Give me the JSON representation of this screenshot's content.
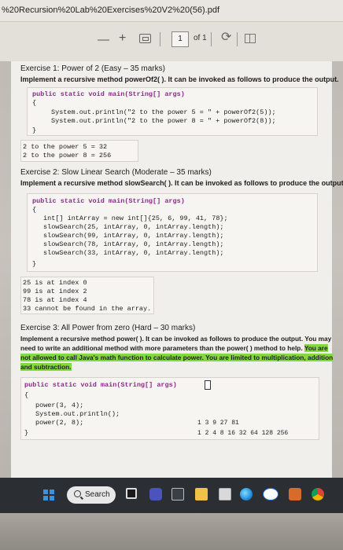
{
  "window": {
    "title": "%20Recursion%20Lab%20Exercises%20V2%20(56).pdf"
  },
  "toolbar": {
    "zoom_out": "—",
    "zoom_in": "+",
    "page_value": "1",
    "page_of": "of 1",
    "icons": [
      "zoom-out-icon",
      "zoom-in-icon",
      "fit-page-icon",
      "rotate-icon",
      "two-page-view-icon"
    ]
  },
  "ex1": {
    "heading": "Exercise 1: Power of 2 (Easy – 35 marks)",
    "instr": "Implement a recursive method powerOf2( ). It can be invoked as follows to produce the output.",
    "code": [
      "public static void main(String[] args)",
      "{",
      "System.out.println(\"2 to the power 5 = \" + powerOf2(5));",
      "System.out.println(\"2 to the power 8 = \" + powerOf2(8));",
      "}"
    ],
    "output": [
      "2 to the power 5 = 32",
      "2 to the power 8 = 256"
    ]
  },
  "ex2": {
    "heading": "Exercise 2: Slow Linear Search (Moderate – 35 marks)",
    "instr": "Implement a recursive method slowSearch( ). It can be invoked as follows to produce the output.",
    "code": [
      "public static void main(String[] args)",
      "{",
      "int[] intArray = new int[]{25, 6, 99, 41, 78};",
      "slowSearch(25, intArray, 0, intArray.length);",
      "slowSearch(99, intArray, 0, intArray.length);",
      "slowSearch(78, intArray, 0, intArray.length);",
      "slowSearch(33, intArray, 0, intArray.length);",
      "}"
    ],
    "output": [
      "25 is at index 0",
      "99 is at index 2",
      "78 is at index 4",
      "33 cannot be found in the array."
    ]
  },
  "ex3": {
    "heading": "Exercise 3: All Power from zero (Hard – 30 marks)",
    "instr1": "Implement a recursive method power( ). It can be invoked as follows to produce the output. You may",
    "instr2": "need to write an additional method with more parameters than the power( ) method to help.",
    "instr2_hl": "You are",
    "instr3_hl": "not allowed to call Java's math function to calculate power. You are limited to multiplication, addition",
    "instr4_hl": "and subtraction.",
    "code": [
      "public static void main(String[] args)",
      "{",
      "power(3, 4);",
      "System.out.println();",
      "power(2, 8);",
      "}"
    ],
    "output": [
      "1   3   9   27   81",
      "1   2   4   8   16   32   64   128   256"
    ]
  },
  "taskbar": {
    "search_label": "Search",
    "icons": [
      "windows-start-icon",
      "search-icon",
      "task-view-icon",
      "teams-icon",
      "file-explorer-icon",
      "folder-icon",
      "edge-icon",
      "dell-icon",
      "office-icon",
      "chrome-icon"
    ]
  },
  "colors": {
    "highlight": "#83d944",
    "keyword": "#8a2c88",
    "taskbar": "#2b2e33"
  }
}
